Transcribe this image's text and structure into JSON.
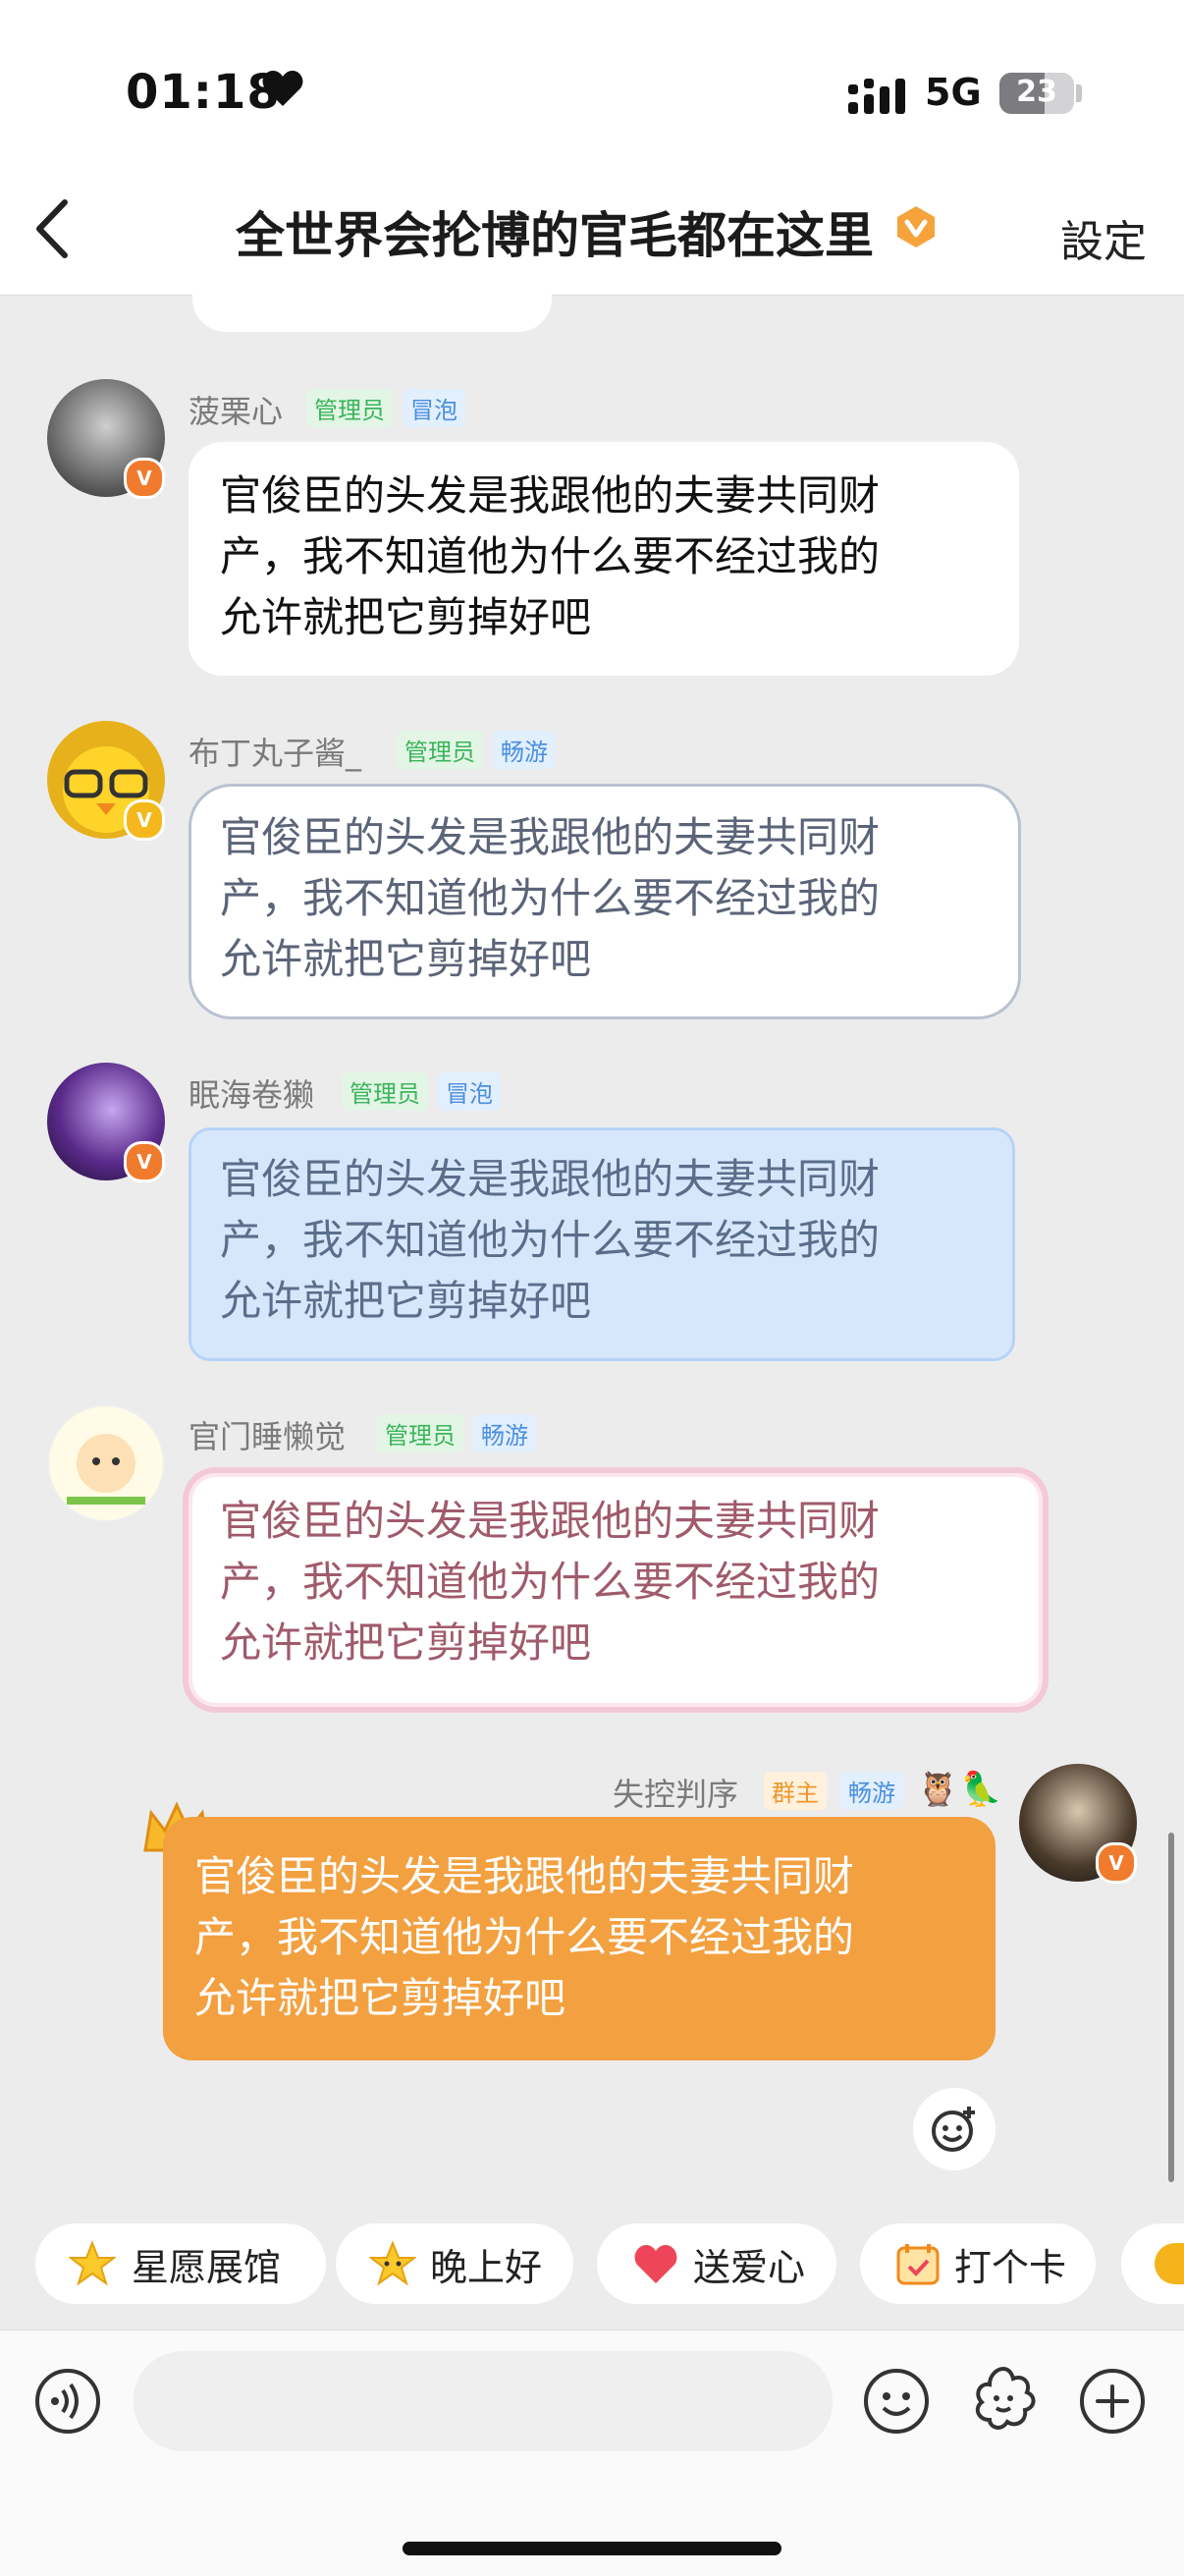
{
  "status_bar": {
    "time": "01:18",
    "network": "5G",
    "battery": "23"
  },
  "nav": {
    "title": "全世界会抡博的官毛都在这里",
    "settings_label": "設定"
  },
  "colors": {
    "owner_bubble": "#f3a040",
    "admin_tag": "#3bb45a",
    "vip_badge": "#f07b2c"
  },
  "messages": [
    {
      "sender": "菠栗心",
      "tags": [
        "管理员",
        "冒泡"
      ],
      "lines": [
        "官俊臣的头发是我跟他的夫妻共同财",
        "产，我不知道他为什么要不经过我的",
        "允许就把它剪掉好吧"
      ]
    },
    {
      "sender": "布丁丸子酱_",
      "tags": [
        "管理员",
        "畅游"
      ],
      "lines": [
        "官俊臣的头发是我跟他的夫妻共同财",
        "产，我不知道他为什么要不经过我的",
        "允许就把它剪掉好吧"
      ]
    },
    {
      "sender": "眠海卷獭",
      "tags": [
        "管理员",
        "冒泡"
      ],
      "lines": [
        "官俊臣的头发是我跟他的夫妻共同财",
        "产，我不知道他为什么要不经过我的",
        "允许就把它剪掉好吧"
      ]
    },
    {
      "sender": "官门睡懒觉",
      "tags": [
        "管理员",
        "畅游"
      ],
      "lines": [
        "官俊臣的头发是我跟他的夫妻共同财",
        "产，我不知道他为什么要不经过我的",
        "允许就把它剪掉好吧"
      ]
    },
    {
      "sender": "失控判序",
      "tags": [
        "群主",
        "畅游"
      ],
      "lines": [
        "官俊臣的头发是我跟他的夫妻共同财",
        "产，我不知道他为什么要不经过我的",
        "允许就把它剪掉好吧"
      ]
    }
  ],
  "quick_chips": [
    {
      "label": "星愿展馆",
      "icon": "star-icon"
    },
    {
      "label": "晚上好",
      "icon": "moon-star-icon"
    },
    {
      "label": "送爱心",
      "icon": "heart-icon"
    },
    {
      "label": "打个卡",
      "icon": "checkin-icon"
    }
  ],
  "bottom_bar": {
    "input_placeholder": ""
  }
}
